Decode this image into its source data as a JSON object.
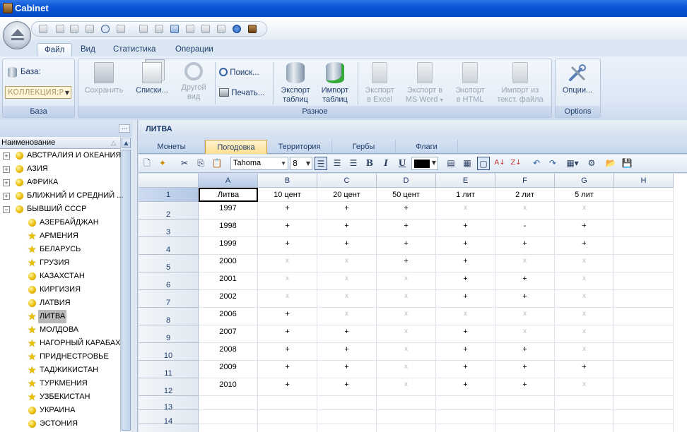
{
  "window": {
    "title": "Cabinet"
  },
  "ribbon_tabs": [
    {
      "label": "Файл",
      "active": true
    },
    {
      "label": "Вид"
    },
    {
      "label": "Статистика"
    },
    {
      "label": "Операции"
    }
  ],
  "ribbon": {
    "baza_label": "База:",
    "baza_value": "КОЛЛЕКЦИЯ;Р",
    "group_baza": "База",
    "save": "Сохранить",
    "lists": "Списки...",
    "other_view_1": "Другой",
    "other_view_2": "вид",
    "search": "Поиск...",
    "print": "Печать...",
    "export_tables_1": "Экспорт",
    "export_tables_2": "таблиц",
    "import_tables_1": "Импорт",
    "import_tables_2": "таблиц",
    "export_excel_1": "Экспорт",
    "export_excel_2": "в Excel",
    "export_word_1": "Экспорт в",
    "export_word_2": "MS Word",
    "export_html_1": "Экспорт",
    "export_html_2": "в HTML",
    "import_text_1": "Импорт из",
    "import_text_2": "текст. файла",
    "group_misc": "Разное",
    "options": "Опции...",
    "group_options": "Options"
  },
  "tree": {
    "more": "...",
    "header": "Наименование",
    "items": [
      {
        "label": "АВСТРАЛИЯ И ОКЕАНИЯ",
        "level": 0,
        "expander": "+",
        "icon": "dot"
      },
      {
        "label": "АЗИЯ",
        "level": 0,
        "expander": "+",
        "icon": "dot"
      },
      {
        "label": "АФРИКА",
        "level": 0,
        "expander": "+",
        "icon": "dot"
      },
      {
        "label": "БЛИЖНИЙ И СРЕДНИЙ ...",
        "level": 0,
        "expander": "+",
        "icon": "dot"
      },
      {
        "label": "БЫВШИЙ СССР",
        "level": 0,
        "expander": "−",
        "icon": "dot"
      },
      {
        "label": "АЗЕРБАЙДЖАН",
        "level": 1,
        "icon": "dot"
      },
      {
        "label": "АРМЕНИЯ",
        "level": 1,
        "icon": "star"
      },
      {
        "label": "БЕЛАРУСЬ",
        "level": 1,
        "icon": "star"
      },
      {
        "label": "ГРУЗИЯ",
        "level": 1,
        "icon": "star"
      },
      {
        "label": "КАЗАХСТАН",
        "level": 1,
        "icon": "dot"
      },
      {
        "label": "КИРГИЗИЯ",
        "level": 1,
        "icon": "dot"
      },
      {
        "label": "ЛАТВИЯ",
        "level": 1,
        "icon": "dot"
      },
      {
        "label": "ЛИТВА",
        "level": 1,
        "icon": "star",
        "selected": true
      },
      {
        "label": "МОЛДОВА",
        "level": 1,
        "icon": "star"
      },
      {
        "label": "НАГОРНЫЙ КАРАБАХ",
        "level": 1,
        "icon": "star"
      },
      {
        "label": "ПРИДНЕСТРОВЬЕ",
        "level": 1,
        "icon": "star"
      },
      {
        "label": "ТАДЖИКИСТАН",
        "level": 1,
        "icon": "star"
      },
      {
        "label": "ТУРКМЕНИЯ",
        "level": 1,
        "icon": "star"
      },
      {
        "label": "УЗБЕКИСТАН",
        "level": 1,
        "icon": "star"
      },
      {
        "label": "УКРАИНА",
        "level": 1,
        "icon": "dot"
      },
      {
        "label": "ЭСТОНИЯ",
        "level": 1,
        "icon": "dot"
      }
    ]
  },
  "document": {
    "title": "ЛИТВА",
    "tabs": [
      {
        "label": "Монеты"
      },
      {
        "label": "Погодовка",
        "active": true
      },
      {
        "label": "Территория"
      },
      {
        "label": "Гербы"
      },
      {
        "label": "Флаги"
      }
    ],
    "font_name": "Tahoma",
    "font_size": "8",
    "text_color": "#000000"
  },
  "sheet": {
    "columns": [
      "A",
      "B",
      "C",
      "D",
      "E",
      "F",
      "G",
      "H"
    ],
    "rows": [
      {
        "n": "1",
        "cells": [
          "Литва",
          "10 цент",
          "20 цент",
          "50 цент",
          "1 лит",
          "2 лит",
          "5 лит",
          ""
        ]
      },
      {
        "n": "2",
        "cells": [
          "1997",
          "+",
          "+",
          "+",
          "x",
          "x",
          "x",
          ""
        ]
      },
      {
        "n": "3",
        "cells": [
          "1998",
          "+",
          "+",
          "+",
          "+",
          "-",
          "+",
          ""
        ]
      },
      {
        "n": "4",
        "cells": [
          "1999",
          "+",
          "+",
          "+",
          "+",
          "+",
          "+",
          ""
        ]
      },
      {
        "n": "5",
        "cells": [
          "2000",
          "x",
          "x",
          "+",
          "+",
          "x",
          "x",
          ""
        ]
      },
      {
        "n": "6",
        "cells": [
          "2001",
          "x",
          "x",
          "x",
          "+",
          "+",
          "x",
          ""
        ]
      },
      {
        "n": "7",
        "cells": [
          "2002",
          "x",
          "x",
          "x",
          "+",
          "+",
          "x",
          ""
        ]
      },
      {
        "n": "8",
        "cells": [
          "2006",
          "+",
          "x",
          "x",
          "x",
          "x",
          "x",
          ""
        ]
      },
      {
        "n": "9",
        "cells": [
          "2007",
          "+",
          "+",
          "x",
          "+",
          "x",
          "x",
          ""
        ]
      },
      {
        "n": "10",
        "cells": [
          "2008",
          "+",
          "+",
          "x",
          "+",
          "+",
          "x",
          ""
        ]
      },
      {
        "n": "11",
        "cells": [
          "2009",
          "+",
          "+",
          "x",
          "+",
          "+",
          "+",
          ""
        ]
      },
      {
        "n": "12",
        "cells": [
          "2010",
          "+",
          "+",
          "x",
          "+",
          "+",
          "x",
          ""
        ]
      },
      {
        "n": "13",
        "cells": [
          "",
          "",
          "",
          "",
          "",
          "",
          "",
          ""
        ]
      },
      {
        "n": "14",
        "cells": [
          "",
          "",
          "",
          "",
          "",
          "",
          "",
          ""
        ]
      },
      {
        "n": "15",
        "cells": [
          "",
          "",
          "",
          "",
          "",
          "",
          "",
          ""
        ]
      }
    ]
  }
}
